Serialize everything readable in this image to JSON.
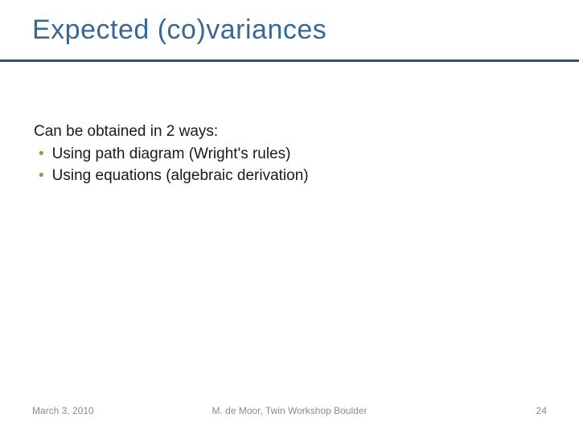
{
  "title": "Expected (co)variances",
  "intro": "Can be obtained in 2 ways:",
  "bullets": [
    "Using path diagram (Wright's rules)",
    "Using equations (algebraic derivation)"
  ],
  "footer": {
    "date": "March 3, 2010",
    "author": "M. de Moor, Twin Workshop Boulder",
    "page": "24"
  }
}
